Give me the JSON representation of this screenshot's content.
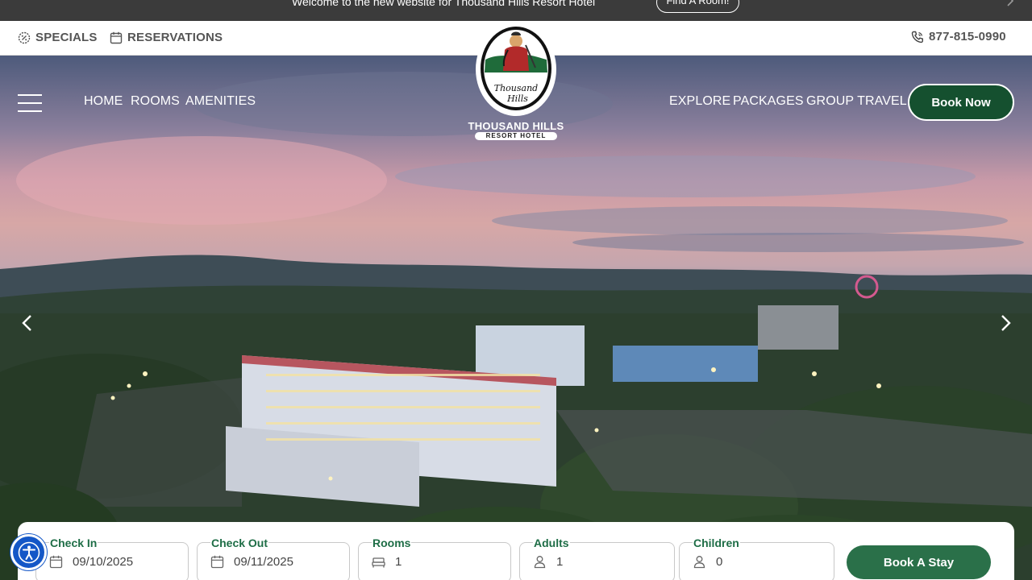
{
  "announcement": {
    "text": "Welcome to the new website for Thousand Hills Resort Hotel",
    "button_label": "Find A Room!"
  },
  "utility_bar": {
    "specials_label": "SPECIALS",
    "reservations_label": "RESERVATIONS",
    "phone": "877-815-0990"
  },
  "logo": {
    "script_text_1": "Thousand",
    "script_text_2": "Hills",
    "name": "THOUSAND HILLS",
    "subtitle": "RESORT HOTEL"
  },
  "nav": {
    "left": [
      "HOME",
      "ROOMS",
      "AMENITIES"
    ],
    "right": [
      "EXPLORE",
      "PACKAGES",
      "GROUP TRAVEL"
    ],
    "book_now_label": "Book Now"
  },
  "booking": {
    "check_in": {
      "label": "Check In",
      "value": "09/10/2025"
    },
    "check_out": {
      "label": "Check Out",
      "value": "09/11/2025"
    },
    "rooms": {
      "label": "Rooms",
      "value": "1"
    },
    "adults": {
      "label": "Adults",
      "value": "1"
    },
    "children": {
      "label": "Children",
      "value": "0"
    },
    "submit_label": "Book A Stay"
  },
  "colors": {
    "brand_green": "#15502f",
    "accent_green": "#2a7049",
    "label_green": "#1e6d46",
    "announce_bg": "#3b3b3b",
    "a11y_blue": "#1457c7"
  },
  "icons": {
    "specials": "discount-badge-icon",
    "reservations": "calendar-icon",
    "phone": "phone-icon",
    "rooms": "bed-icon",
    "guests": "person-icon",
    "accessibility": "accessibility-icon"
  }
}
